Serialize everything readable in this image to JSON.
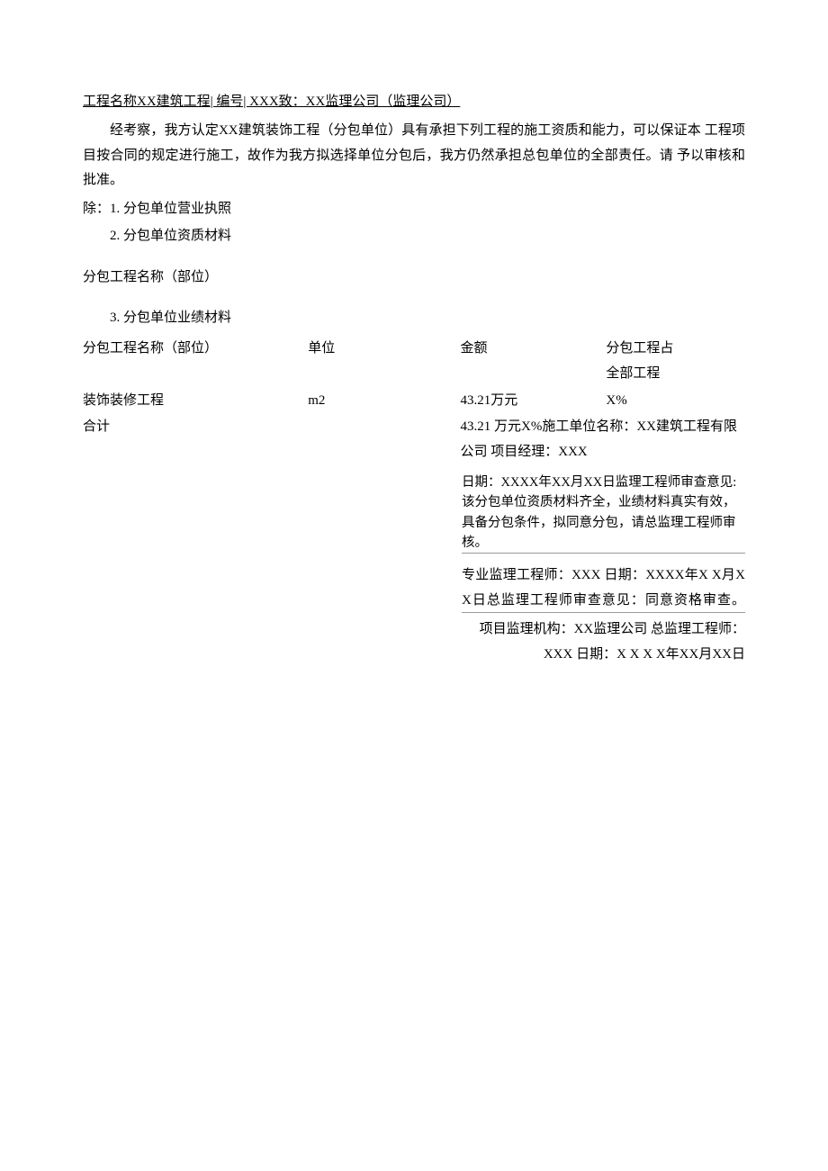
{
  "header": {
    "line": "工程名称XX建筑工程| 编号| XXX致：XX监理公司（监理公司）"
  },
  "body_para": "经考察，我方认定XX建筑装饰工程（分包单位）具有承担下列工程的施工资质和能力，可以保证本 工程项目按合同的规定进行施工，故作为我方拟选择单位分包后，我方仍然承担总包单位的全部责任。请 予以审核和批准。",
  "except_line": "除：1. 分包单位营业执照",
  "list_item2": "2. 分包单位资质材料",
  "section_label": "分包工程名称（部位）",
  "list_item3": "3. 分包单位业绩材料",
  "table": {
    "headers": {
      "name": "分包工程名称（部位）",
      "unit": "单位",
      "amount": "金额",
      "pct_line1": "分包工程占",
      "pct_line2": "全部工程"
    },
    "row": {
      "name": "装饰装修工程",
      "unit": "m2",
      "amount": "43.21万元",
      "pct": "X%"
    },
    "total_label": "合计",
    "total_right": "43.21 万元X%施工单位名称：XX建筑工程有限公司 项目经理：XXX"
  },
  "right_block": {
    "r1": "日期：XXXX年XX月XX日监理工程师审查意见: 该分包单位资质材料齐全，业绩材料真实有效，具备分包条件，拟同意分包，请总监理工程师审核。",
    "r2": "专业监理工程师：XXX 日期：XXXX年X X月X X日总监理工程师审查意见：同意资格审查。",
    "r3": "项目监理机构：XX监理公司  总监理工程师：XXX 日期：X X X X年XX月XX日"
  }
}
